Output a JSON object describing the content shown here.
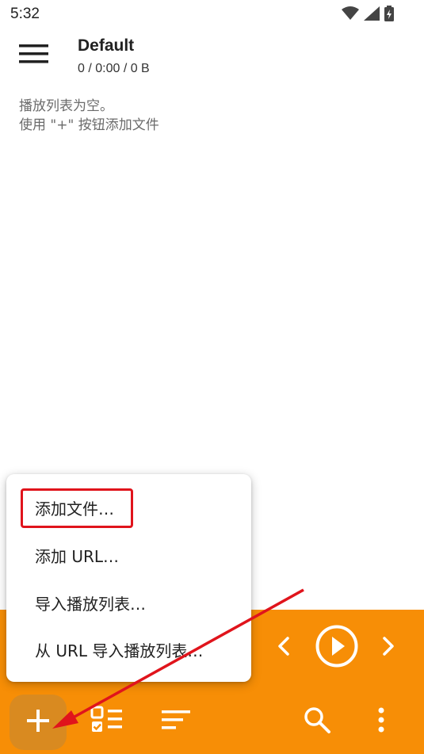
{
  "status_bar": {
    "time": "5:32"
  },
  "app_bar": {
    "title": "Default",
    "subtitle": "0 / 0:00 / 0 B"
  },
  "empty_state": {
    "line1": "播放列表为空。",
    "line2": "使用 \"+\" 按钮添加文件"
  },
  "popup_menu": {
    "items": [
      {
        "label": "添加文件…"
      },
      {
        "label": "添加 URL…"
      },
      {
        "label": "导入播放列表…"
      },
      {
        "label": "从 URL 导入播放列表…"
      }
    ]
  },
  "annotation": {
    "highlight_color": "#e0141c",
    "arrow_color": "#e0141c"
  },
  "colors": {
    "player_bar": "#f78e06",
    "fab": "#d98a20"
  },
  "icons": [
    "wifi-icon",
    "signal-icon",
    "battery-icon",
    "menu-icon",
    "previous-icon",
    "play-icon",
    "next-icon",
    "add-icon",
    "select-list-icon",
    "sort-icon",
    "search-icon",
    "more-vert-icon"
  ]
}
